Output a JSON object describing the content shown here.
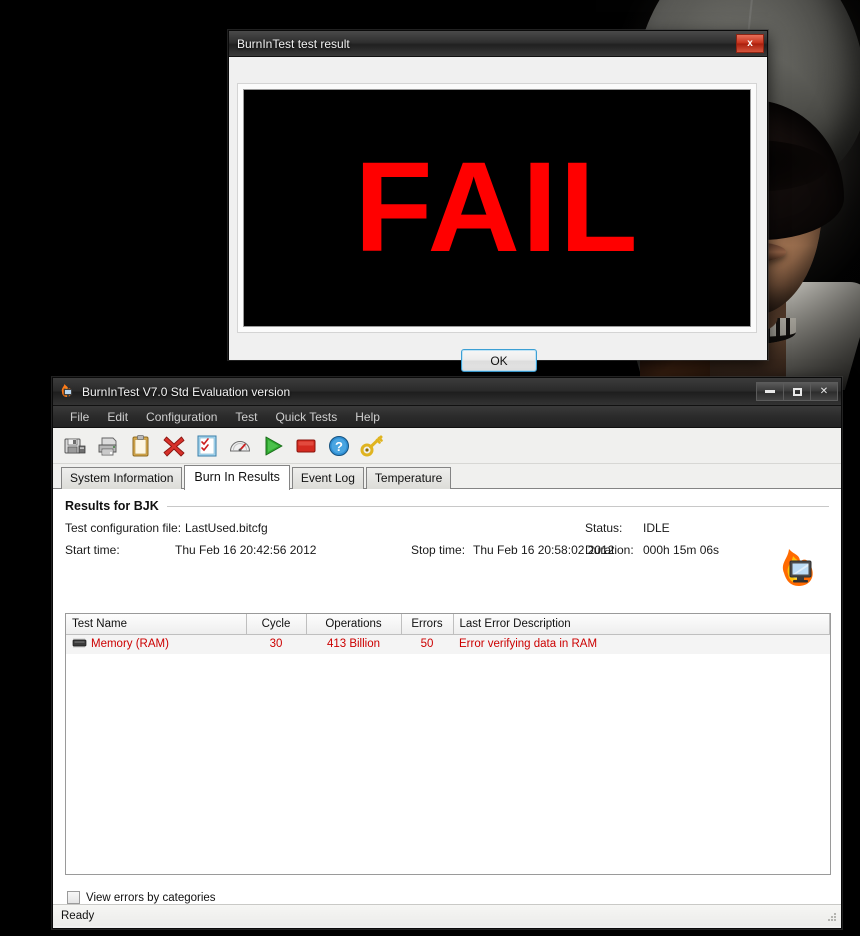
{
  "desktop": {
    "wallpaper_name": "hooded-figure-wallpaper"
  },
  "dialog": {
    "title": "BurnInTest test result",
    "result_text": "FAIL",
    "ok_label": "OK",
    "close_glyph": "x",
    "result_color": "#ff0000",
    "panel_color": "#000000"
  },
  "main_window": {
    "title": "BurnInTest V7.0 Std Evaluation version",
    "icon": "burning-monitor-icon",
    "window_buttons": {
      "minimize": "–",
      "maximize": "▭",
      "close": "✕"
    },
    "menu": [
      "File",
      "Edit",
      "Configuration",
      "Test",
      "Quick Tests",
      "Help"
    ],
    "toolbar": [
      {
        "name": "save-icon",
        "tip": "Save"
      },
      {
        "name": "print-icon",
        "tip": "Print"
      },
      {
        "name": "clipboard-icon",
        "tip": "Clipboard"
      },
      {
        "name": "delete-x-icon",
        "tip": "Clear"
      },
      {
        "name": "checklist-icon",
        "tip": "Test selection"
      },
      {
        "name": "gauge-icon",
        "tip": "Benchmark"
      },
      {
        "name": "play-icon",
        "tip": "Start test"
      },
      {
        "name": "stop-icon",
        "tip": "Stop test"
      },
      {
        "name": "help-icon",
        "tip": "Help"
      },
      {
        "name": "key-icon",
        "tip": "Licence key"
      }
    ],
    "tabs": [
      {
        "label": "System Information",
        "active": false
      },
      {
        "label": "Burn In Results",
        "active": true
      },
      {
        "label": "Event Log",
        "active": false
      },
      {
        "label": "Temperature",
        "active": false
      }
    ],
    "results": {
      "group_title": "Results for BJK",
      "config_label": "Test configuration file:",
      "config_value": "LastUsed.bitcfg",
      "start_label": "Start time:",
      "start_value": "Thu Feb 16 20:42:56 2012",
      "stop_label": "Stop time:",
      "stop_value": "Thu Feb 16 20:58:02 2012",
      "status_label": "Status:",
      "status_value": "IDLE",
      "duration_label": "Duration:",
      "duration_value": "000h 15m 06s",
      "logo": "burning-monitor-icon",
      "columns": [
        "Test Name",
        "Cycle",
        "Operations",
        "Errors",
        "Last Error Description"
      ],
      "rows": [
        {
          "icon": "ram-chip-icon",
          "test_name": "Memory  (RAM)",
          "cycle": "30",
          "operations": "413 Billion",
          "errors": "50",
          "last_error": "Error verifying data in RAM",
          "row_color": "#cc0000"
        }
      ]
    },
    "footer": {
      "checkbox_label": "View errors by categories",
      "checkbox_checked": false
    },
    "status_bar": {
      "text": "Ready"
    }
  }
}
